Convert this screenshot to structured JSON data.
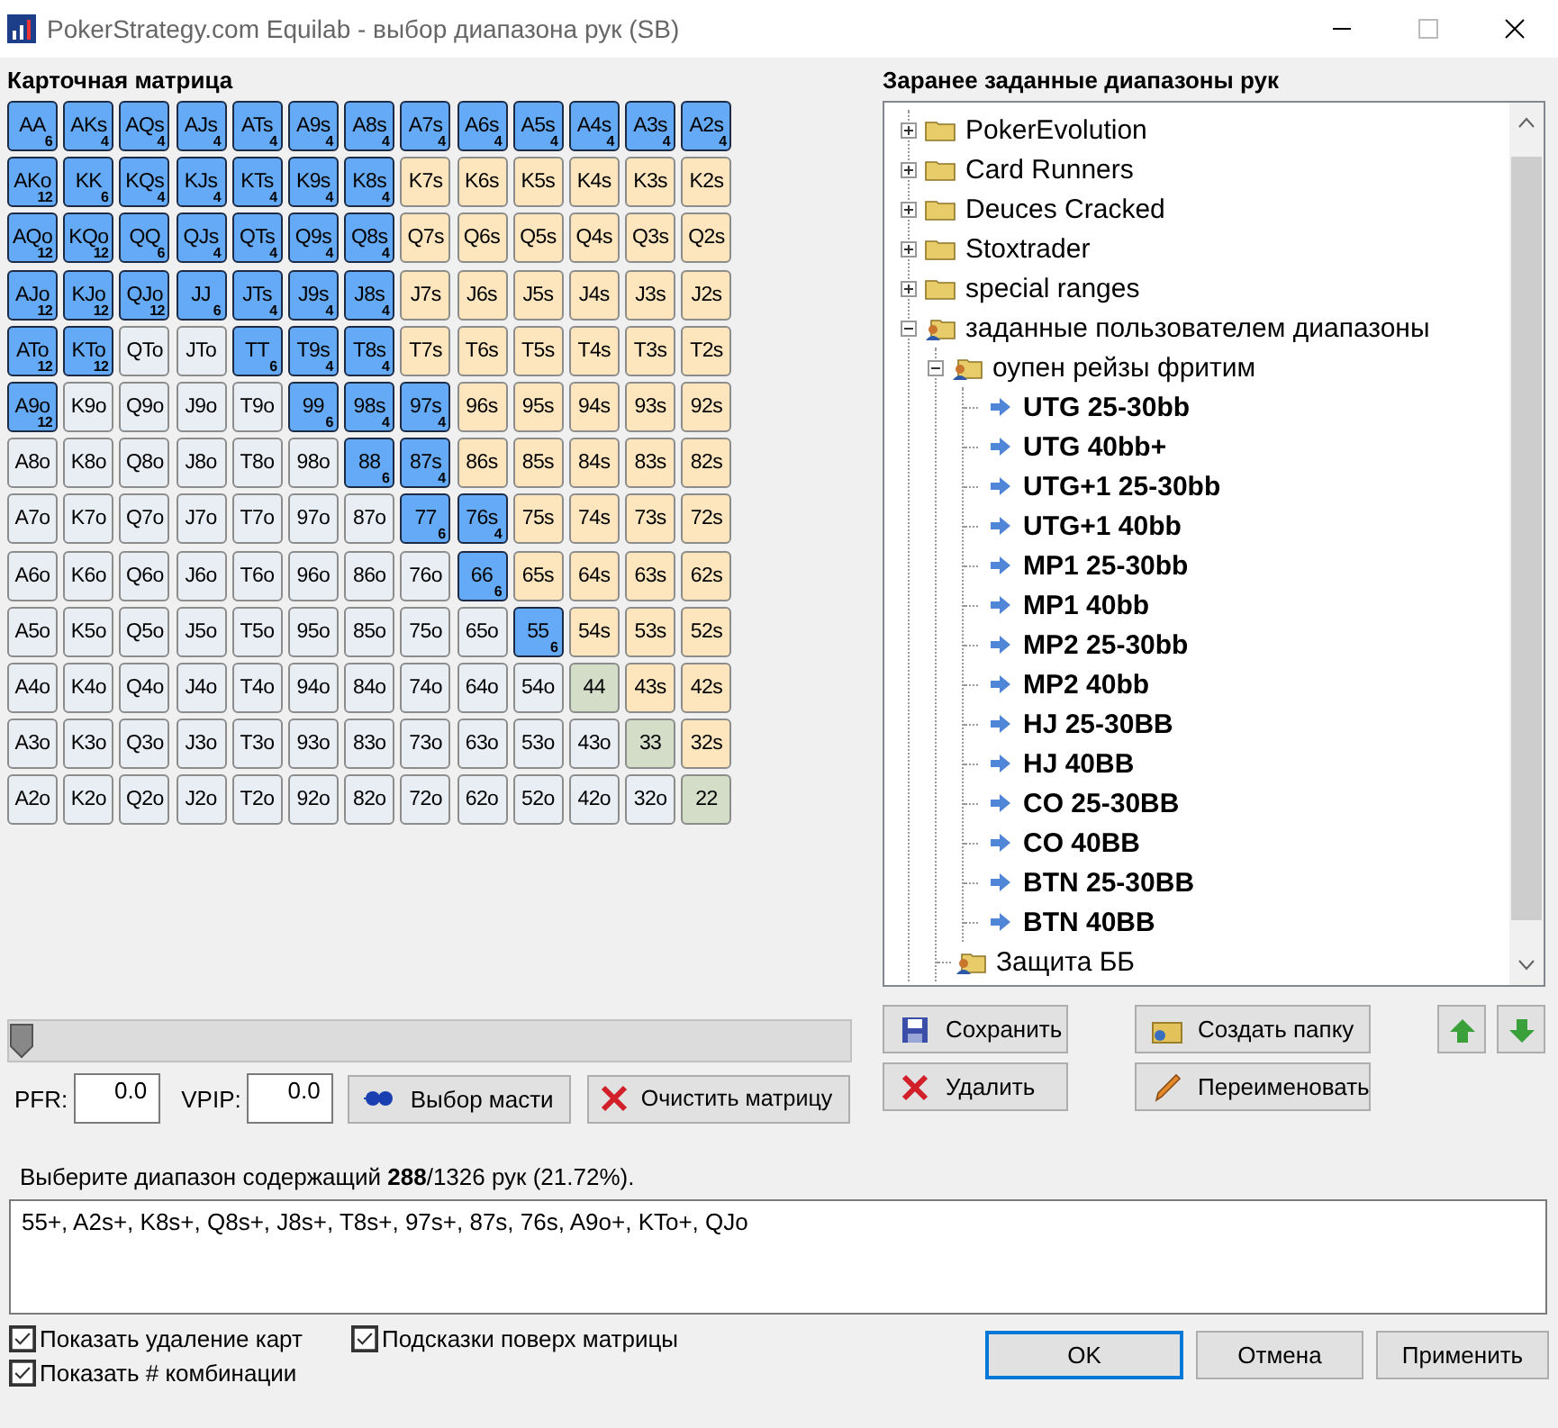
{
  "window": {
    "title": "PokerStrategy.com Equilab - выбор диапазона рук (SB)"
  },
  "matrix": {
    "title": "Карточная матрица",
    "rows": [
      [
        {
          "label": "AA",
          "kind": "pair",
          "selected": true,
          "count": "6"
        },
        {
          "label": "AKs",
          "kind": "suited",
          "selected": true,
          "count": "4"
        },
        {
          "label": "AQs",
          "kind": "suited",
          "selected": true,
          "count": "4"
        },
        {
          "label": "AJs",
          "kind": "suited",
          "selected": true,
          "count": "4"
        },
        {
          "label": "ATs",
          "kind": "suited",
          "selected": true,
          "count": "4"
        },
        {
          "label": "A9s",
          "kind": "suited",
          "selected": true,
          "count": "4"
        },
        {
          "label": "A8s",
          "kind": "suited",
          "selected": true,
          "count": "4"
        },
        {
          "label": "A7s",
          "kind": "suited",
          "selected": true,
          "count": "4"
        },
        {
          "label": "A6s",
          "kind": "suited",
          "selected": true,
          "count": "4"
        },
        {
          "label": "A5s",
          "kind": "suited",
          "selected": true,
          "count": "4"
        },
        {
          "label": "A4s",
          "kind": "suited",
          "selected": true,
          "count": "4"
        },
        {
          "label": "A3s",
          "kind": "suited",
          "selected": true,
          "count": "4"
        },
        {
          "label": "A2s",
          "kind": "suited",
          "selected": true,
          "count": "4"
        }
      ],
      [
        {
          "label": "AKo",
          "kind": "offsuit",
          "selected": true,
          "count": "12"
        },
        {
          "label": "KK",
          "kind": "pair",
          "selected": true,
          "count": "6"
        },
        {
          "label": "KQs",
          "kind": "suited",
          "selected": true,
          "count": "4"
        },
        {
          "label": "KJs",
          "kind": "suited",
          "selected": true,
          "count": "4"
        },
        {
          "label": "KTs",
          "kind": "suited",
          "selected": true,
          "count": "4"
        },
        {
          "label": "K9s",
          "kind": "suited",
          "selected": true,
          "count": "4"
        },
        {
          "label": "K8s",
          "kind": "suited",
          "selected": true,
          "count": "4"
        },
        {
          "label": "K7s",
          "kind": "suited",
          "selected": false
        },
        {
          "label": "K6s",
          "kind": "suited",
          "selected": false
        },
        {
          "label": "K5s",
          "kind": "suited",
          "selected": false
        },
        {
          "label": "K4s",
          "kind": "suited",
          "selected": false
        },
        {
          "label": "K3s",
          "kind": "suited",
          "selected": false
        },
        {
          "label": "K2s",
          "kind": "suited",
          "selected": false
        }
      ],
      [
        {
          "label": "AQo",
          "kind": "offsuit",
          "selected": true,
          "count": "12"
        },
        {
          "label": "KQo",
          "kind": "offsuit",
          "selected": true,
          "count": "12"
        },
        {
          "label": "QQ",
          "kind": "pair",
          "selected": true,
          "count": "6"
        },
        {
          "label": "QJs",
          "kind": "suited",
          "selected": true,
          "count": "4"
        },
        {
          "label": "QTs",
          "kind": "suited",
          "selected": true,
          "count": "4"
        },
        {
          "label": "Q9s",
          "kind": "suited",
          "selected": true,
          "count": "4"
        },
        {
          "label": "Q8s",
          "kind": "suited",
          "selected": true,
          "count": "4"
        },
        {
          "label": "Q7s",
          "kind": "suited",
          "selected": false
        },
        {
          "label": "Q6s",
          "kind": "suited",
          "selected": false
        },
        {
          "label": "Q5s",
          "kind": "suited",
          "selected": false
        },
        {
          "label": "Q4s",
          "kind": "suited",
          "selected": false
        },
        {
          "label": "Q3s",
          "kind": "suited",
          "selected": false
        },
        {
          "label": "Q2s",
          "kind": "suited",
          "selected": false
        }
      ],
      [
        {
          "label": "AJo",
          "kind": "offsuit",
          "selected": true,
          "count": "12"
        },
        {
          "label": "KJo",
          "kind": "offsuit",
          "selected": true,
          "count": "12"
        },
        {
          "label": "QJo",
          "kind": "offsuit",
          "selected": true,
          "count": "12"
        },
        {
          "label": "JJ",
          "kind": "pair",
          "selected": true,
          "count": "6"
        },
        {
          "label": "JTs",
          "kind": "suited",
          "selected": true,
          "count": "4"
        },
        {
          "label": "J9s",
          "kind": "suited",
          "selected": true,
          "count": "4"
        },
        {
          "label": "J8s",
          "kind": "suited",
          "selected": true,
          "count": "4"
        },
        {
          "label": "J7s",
          "kind": "suited",
          "selected": false
        },
        {
          "label": "J6s",
          "kind": "suited",
          "selected": false
        },
        {
          "label": "J5s",
          "kind": "suited",
          "selected": false
        },
        {
          "label": "J4s",
          "kind": "suited",
          "selected": false
        },
        {
          "label": "J3s",
          "kind": "suited",
          "selected": false
        },
        {
          "label": "J2s",
          "kind": "suited",
          "selected": false
        }
      ],
      [
        {
          "label": "ATo",
          "kind": "offsuit",
          "selected": true,
          "count": "12"
        },
        {
          "label": "KTo",
          "kind": "offsuit",
          "selected": true,
          "count": "12"
        },
        {
          "label": "QTo",
          "kind": "offsuit",
          "selected": false
        },
        {
          "label": "JTo",
          "kind": "offsuit",
          "selected": false
        },
        {
          "label": "TT",
          "kind": "pair",
          "selected": true,
          "count": "6"
        },
        {
          "label": "T9s",
          "kind": "suited",
          "selected": true,
          "count": "4"
        },
        {
          "label": "T8s",
          "kind": "suited",
          "selected": true,
          "count": "4"
        },
        {
          "label": "T7s",
          "kind": "suited",
          "selected": false
        },
        {
          "label": "T6s",
          "kind": "suited",
          "selected": false
        },
        {
          "label": "T5s",
          "kind": "suited",
          "selected": false
        },
        {
          "label": "T4s",
          "kind": "suited",
          "selected": false
        },
        {
          "label": "T3s",
          "kind": "suited",
          "selected": false
        },
        {
          "label": "T2s",
          "kind": "suited",
          "selected": false
        }
      ],
      [
        {
          "label": "A9o",
          "kind": "offsuit",
          "selected": true,
          "count": "12"
        },
        {
          "label": "K9o",
          "kind": "offsuit",
          "selected": false
        },
        {
          "label": "Q9o",
          "kind": "offsuit",
          "selected": false
        },
        {
          "label": "J9o",
          "kind": "offsuit",
          "selected": false
        },
        {
          "label": "T9o",
          "kind": "offsuit",
          "selected": false
        },
        {
          "label": "99",
          "kind": "pair",
          "selected": true,
          "count": "6"
        },
        {
          "label": "98s",
          "kind": "suited",
          "selected": true,
          "count": "4"
        },
        {
          "label": "97s",
          "kind": "suited",
          "selected": true,
          "count": "4"
        },
        {
          "label": "96s",
          "kind": "suited",
          "selected": false
        },
        {
          "label": "95s",
          "kind": "suited",
          "selected": false
        },
        {
          "label": "94s",
          "kind": "suited",
          "selected": false
        },
        {
          "label": "93s",
          "kind": "suited",
          "selected": false
        },
        {
          "label": "92s",
          "kind": "suited",
          "selected": false
        }
      ],
      [
        {
          "label": "A8o",
          "kind": "offsuit",
          "selected": false
        },
        {
          "label": "K8o",
          "kind": "offsuit",
          "selected": false
        },
        {
          "label": "Q8o",
          "kind": "offsuit",
          "selected": false
        },
        {
          "label": "J8o",
          "kind": "offsuit",
          "selected": false
        },
        {
          "label": "T8o",
          "kind": "offsuit",
          "selected": false
        },
        {
          "label": "98o",
          "kind": "offsuit",
          "selected": false
        },
        {
          "label": "88",
          "kind": "pair",
          "selected": true,
          "count": "6"
        },
        {
          "label": "87s",
          "kind": "suited",
          "selected": true,
          "count": "4"
        },
        {
          "label": "86s",
          "kind": "suited",
          "selected": false
        },
        {
          "label": "85s",
          "kind": "suited",
          "selected": false
        },
        {
          "label": "84s",
          "kind": "suited",
          "selected": false
        },
        {
          "label": "83s",
          "kind": "suited",
          "selected": false
        },
        {
          "label": "82s",
          "kind": "suited",
          "selected": false
        }
      ],
      [
        {
          "label": "A7o",
          "kind": "offsuit",
          "selected": false
        },
        {
          "label": "K7o",
          "kind": "offsuit",
          "selected": false
        },
        {
          "label": "Q7o",
          "kind": "offsuit",
          "selected": false
        },
        {
          "label": "J7o",
          "kind": "offsuit",
          "selected": false
        },
        {
          "label": "T7o",
          "kind": "offsuit",
          "selected": false
        },
        {
          "label": "97o",
          "kind": "offsuit",
          "selected": false
        },
        {
          "label": "87o",
          "kind": "offsuit",
          "selected": false
        },
        {
          "label": "77",
          "kind": "pair",
          "selected": true,
          "count": "6"
        },
        {
          "label": "76s",
          "kind": "suited",
          "selected": true,
          "count": "4"
        },
        {
          "label": "75s",
          "kind": "suited",
          "selected": false
        },
        {
          "label": "74s",
          "kind": "suited",
          "selected": false
        },
        {
          "label": "73s",
          "kind": "suited",
          "selected": false
        },
        {
          "label": "72s",
          "kind": "suited",
          "selected": false
        }
      ],
      [
        {
          "label": "A6o",
          "kind": "offsuit",
          "selected": false
        },
        {
          "label": "K6o",
          "kind": "offsuit",
          "selected": false
        },
        {
          "label": "Q6o",
          "kind": "offsuit",
          "selected": false
        },
        {
          "label": "J6o",
          "kind": "offsuit",
          "selected": false
        },
        {
          "label": "T6o",
          "kind": "offsuit",
          "selected": false
        },
        {
          "label": "96o",
          "kind": "offsuit",
          "selected": false
        },
        {
          "label": "86o",
          "kind": "offsuit",
          "selected": false
        },
        {
          "label": "76o",
          "kind": "offsuit",
          "selected": false
        },
        {
          "label": "66",
          "kind": "pair",
          "selected": true,
          "count": "6"
        },
        {
          "label": "65s",
          "kind": "suited",
          "selected": false
        },
        {
          "label": "64s",
          "kind": "suited",
          "selected": false
        },
        {
          "label": "63s",
          "kind": "suited",
          "selected": false
        },
        {
          "label": "62s",
          "kind": "suited",
          "selected": false
        }
      ],
      [
        {
          "label": "A5o",
          "kind": "offsuit",
          "selected": false
        },
        {
          "label": "K5o",
          "kind": "offsuit",
          "selected": false
        },
        {
          "label": "Q5o",
          "kind": "offsuit",
          "selected": false
        },
        {
          "label": "J5o",
          "kind": "offsuit",
          "selected": false
        },
        {
          "label": "T5o",
          "kind": "offsuit",
          "selected": false
        },
        {
          "label": "95o",
          "kind": "offsuit",
          "selected": false
        },
        {
          "label": "85o",
          "kind": "offsuit",
          "selected": false
        },
        {
          "label": "75o",
          "kind": "offsuit",
          "selected": false
        },
        {
          "label": "65o",
          "kind": "offsuit",
          "selected": false
        },
        {
          "label": "55",
          "kind": "pair",
          "selected": true,
          "count": "6"
        },
        {
          "label": "54s",
          "kind": "suited",
          "selected": false
        },
        {
          "label": "53s",
          "kind": "suited",
          "selected": false
        },
        {
          "label": "52s",
          "kind": "suited",
          "selected": false
        }
      ],
      [
        {
          "label": "A4o",
          "kind": "offsuit",
          "selected": false
        },
        {
          "label": "K4o",
          "kind": "offsuit",
          "selected": false
        },
        {
          "label": "Q4o",
          "kind": "offsuit",
          "selected": false
        },
        {
          "label": "J4o",
          "kind": "offsuit",
          "selected": false
        },
        {
          "label": "T4o",
          "kind": "offsuit",
          "selected": false
        },
        {
          "label": "94o",
          "kind": "offsuit",
          "selected": false
        },
        {
          "label": "84o",
          "kind": "offsuit",
          "selected": false
        },
        {
          "label": "74o",
          "kind": "offsuit",
          "selected": false
        },
        {
          "label": "64o",
          "kind": "offsuit",
          "selected": false
        },
        {
          "label": "54o",
          "kind": "offsuit",
          "selected": false
        },
        {
          "label": "44",
          "kind": "pair",
          "selected": false
        },
        {
          "label": "43s",
          "kind": "suited",
          "selected": false
        },
        {
          "label": "42s",
          "kind": "suited",
          "selected": false
        }
      ],
      [
        {
          "label": "A3o",
          "kind": "offsuit",
          "selected": false
        },
        {
          "label": "K3o",
          "kind": "offsuit",
          "selected": false
        },
        {
          "label": "Q3o",
          "kind": "offsuit",
          "selected": false
        },
        {
          "label": "J3o",
          "kind": "offsuit",
          "selected": false
        },
        {
          "label": "T3o",
          "kind": "offsuit",
          "selected": false
        },
        {
          "label": "93o",
          "kind": "offsuit",
          "selected": false
        },
        {
          "label": "83o",
          "kind": "offsuit",
          "selected": false
        },
        {
          "label": "73o",
          "kind": "offsuit",
          "selected": false
        },
        {
          "label": "63o",
          "kind": "offsuit",
          "selected": false
        },
        {
          "label": "53o",
          "kind": "offsuit",
          "selected": false
        },
        {
          "label": "43o",
          "kind": "offsuit",
          "selected": false
        },
        {
          "label": "33",
          "kind": "pair",
          "selected": false
        },
        {
          "label": "32s",
          "kind": "suited",
          "selected": false
        }
      ],
      [
        {
          "label": "A2o",
          "kind": "offsuit",
          "selected": false
        },
        {
          "label": "K2o",
          "kind": "offsuit",
          "selected": false
        },
        {
          "label": "Q2o",
          "kind": "offsuit",
          "selected": false
        },
        {
          "label": "J2o",
          "kind": "offsuit",
          "selected": false
        },
        {
          "label": "T2o",
          "kind": "offsuit",
          "selected": false
        },
        {
          "label": "92o",
          "kind": "offsuit",
          "selected": false
        },
        {
          "label": "82o",
          "kind": "offsuit",
          "selected": false
        },
        {
          "label": "72o",
          "kind": "offsuit",
          "selected": false
        },
        {
          "label": "62o",
          "kind": "offsuit",
          "selected": false
        },
        {
          "label": "52o",
          "kind": "offsuit",
          "selected": false
        },
        {
          "label": "42o",
          "kind": "offsuit",
          "selected": false
        },
        {
          "label": "32o",
          "kind": "offsuit",
          "selected": false
        },
        {
          "label": "22",
          "kind": "pair",
          "selected": false
        }
      ]
    ]
  },
  "slider": {
    "level": 0.0
  },
  "stats": [
    {
      "label": "PFR:",
      "value": "0.0"
    },
    {
      "label": "VPIP:",
      "value": "0.0"
    }
  ],
  "matrix_buttons": [
    {
      "label": "Выбор масти",
      "kind": "suit"
    },
    {
      "label": "Очистить матрицу",
      "kind": "clear"
    }
  ],
  "presets": {
    "title": "Заранее заданные диапазоны рук",
    "tree": [
      {
        "label": "PokerEvolution",
        "kind": "folder",
        "expanded": false
      },
      {
        "label": "Card Runners",
        "kind": "folder",
        "expanded": false
      },
      {
        "label": "Deuces Cracked",
        "kind": "folder",
        "expanded": false
      },
      {
        "label": "Stoxtrader",
        "kind": "folder",
        "expanded": false
      },
      {
        "label": "special ranges",
        "kind": "folder",
        "expanded": false
      },
      {
        "label": "заданные пользователем диапазоны",
        "kind": "user_folder",
        "expanded": true,
        "children": [
          {
            "label": "оупен рейзы фритим",
            "kind": "user_folder",
            "expanded": true,
            "children": [
              {
                "label": "UTG 25-30bb",
                "kind": "range"
              },
              {
                "label": "UTG 40bb+",
                "kind": "range"
              },
              {
                "label": "UTG+1 25-30bb",
                "kind": "range"
              },
              {
                "label": "UTG+1 40bb",
                "kind": "range"
              },
              {
                "label": "MP1 25-30bb",
                "kind": "range"
              },
              {
                "label": "MP1 40bb",
                "kind": "range"
              },
              {
                "label": "MP2 25-30bb",
                "kind": "range"
              },
              {
                "label": "MP2 40bb",
                "kind": "range"
              },
              {
                "label": "HJ 25-30BB",
                "kind": "range"
              },
              {
                "label": "HJ 40BB",
                "kind": "range"
              },
              {
                "label": "CO 25-30BB",
                "kind": "range"
              },
              {
                "label": "CO 40BB",
                "kind": "range"
              },
              {
                "label": "BTN 25-30BB",
                "kind": "range"
              },
              {
                "label": "BTN 40BB",
                "kind": "range"
              }
            ]
          },
          {
            "label": "Защита ББ",
            "kind": "user_folder"
          }
        ]
      }
    ],
    "buttons": [
      {
        "label": "Сохранить",
        "kind": "save"
      },
      {
        "label": "Создать папку",
        "kind": "new_folder"
      },
      {
        "kind": "up"
      },
      {
        "kind": "down"
      },
      {
        "label": "Удалить",
        "kind": "delete"
      },
      {
        "label": "Переименовать",
        "kind": "rename"
      }
    ]
  },
  "summary": "Выберите диапазон содержащий **288**/1326 рук (21.72%).",
  "range_text": "55+, A2s+, K8s+, Q8s+, J8s+, T8s+, 97s+, 87s, 76s, A9o+, KTo+, QJo",
  "options": [
    {
      "label": "Показать удаление карт",
      "checked": true
    },
    {
      "label": "Подсказки поверх матрицы",
      "checked": true
    },
    {
      "label": "Показать # комбинации",
      "checked": true
    }
  ],
  "dialog_buttons": [
    {
      "label": "OK",
      "default": true
    },
    {
      "label": "Отмена",
      "default": false
    },
    {
      "label": "Применить",
      "default": false
    }
  ]
}
